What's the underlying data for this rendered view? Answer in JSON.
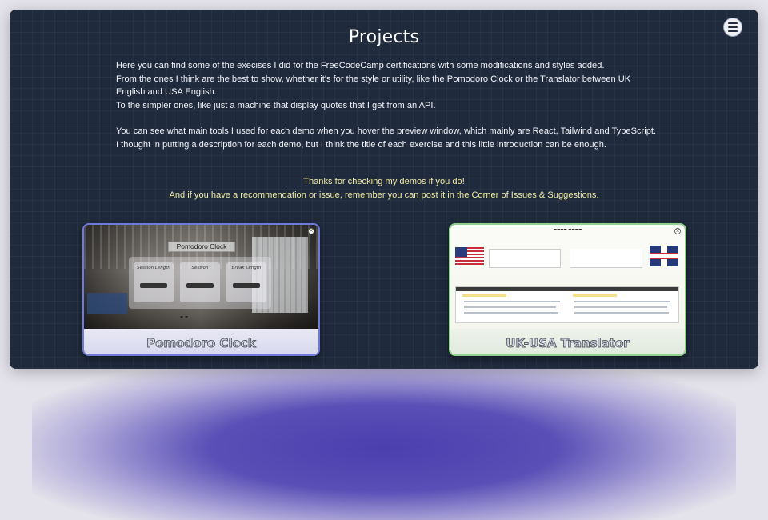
{
  "page": {
    "title": "Projects",
    "menu_icon": "hamburger-menu-icon"
  },
  "intro": {
    "lines": [
      "Here you can find some of the execises I did for the FreeCodeCamp certifications with some modifications and styles added.",
      "From the ones I think are the best to show, whether it's for the style or utility, like the Pomodoro Clock or the Translator between UK English and USA English.",
      "To the simpler ones, like just a machine that display quotes that I get from an API.",
      "You can see what main tools I used for each demo when you hover the preview window, which mainly are React, Tailwind and TypeScript.",
      "I thought in putting a description for each demo, but I think the title of each exercise and this little introduction can be enough."
    ]
  },
  "thanks": {
    "line1": "Thanks for checking my demos if you do!",
    "line2": "And if you have a recommendation or issue, remember you can post it in the Corner of Issues & Suggestions."
  },
  "projects": [
    {
      "label": "Pomodoro Clock",
      "preview_title": "Pomodoro Clock",
      "accent": "#6d7ad8"
    },
    {
      "label": "UK-USA Translator",
      "accent": "#8fd08f"
    }
  ],
  "colors": {
    "panel_bg": "#1f2a3c",
    "thanks_text": "#f0e9a6",
    "glow": "#4a3fae"
  }
}
